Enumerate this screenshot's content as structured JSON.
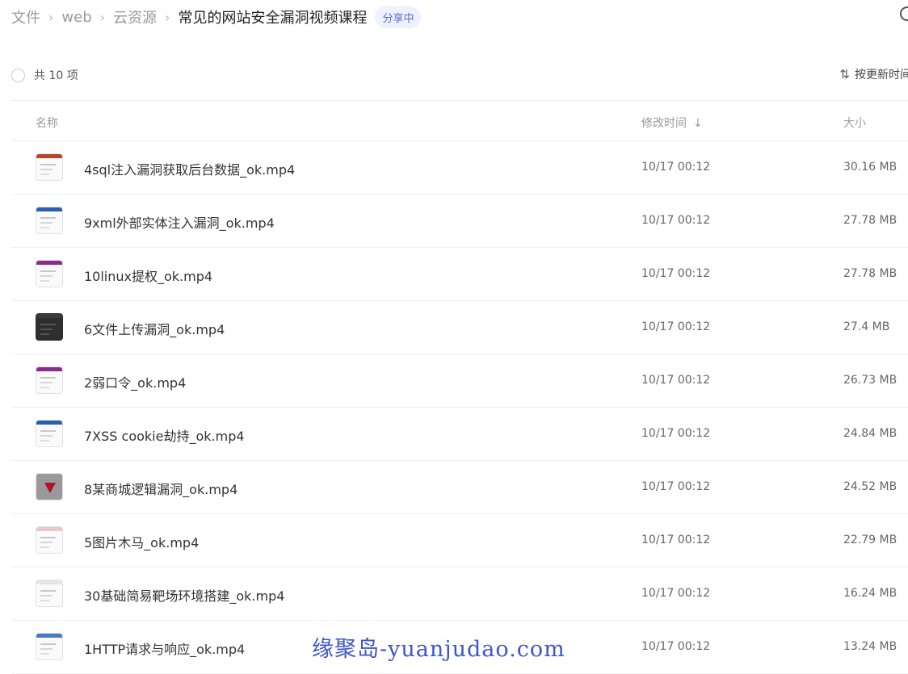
{
  "breadcrumb": {
    "items": [
      "文件",
      "web",
      "云资源"
    ],
    "current": "常见的网站安全漏洞视频课程",
    "badge": "分享中"
  },
  "toolbar": {
    "count_label": "共 10 项",
    "sort_label": "按更新时间"
  },
  "columns": {
    "name": "名称",
    "time": "修改时间",
    "size": "大小",
    "time_sort_arrow": "↓"
  },
  "files": [
    {
      "name": "4sql注入漏洞获取后台数据_ok.mp4",
      "time": "10/17 00:12",
      "size": "30.16 MB",
      "thumb_color": "#b5462a"
    },
    {
      "name": "9xml外部实体注入漏洞_ok.mp4",
      "time": "10/17 00:12",
      "size": "27.78 MB",
      "thumb_color": "#2b5fb4"
    },
    {
      "name": "10linux提权_ok.mp4",
      "time": "10/17 00:12",
      "size": "27.78 MB",
      "thumb_color": "#8a2a8a"
    },
    {
      "name": "6文件上传漏洞_ok.mp4",
      "time": "10/17 00:12",
      "size": "27.4 MB",
      "thumb_color": "#3a3a3a"
    },
    {
      "name": "2弱口令_ok.mp4",
      "time": "10/17 00:12",
      "size": "26.73 MB",
      "thumb_color": "#8a2a8a"
    },
    {
      "name": "7XSS cookie劫持_ok.mp4",
      "time": "10/17 00:12",
      "size": "24.84 MB",
      "thumb_color": "#2b5fb4"
    },
    {
      "name": "8某商城逻辑漏洞_ok.mp4",
      "time": "10/17 00:12",
      "size": "24.52 MB",
      "thumb_color": "#b3112a"
    },
    {
      "name": "5图片木马_ok.mp4",
      "time": "10/17 00:12",
      "size": "22.79 MB",
      "thumb_color": "#e8c8c8"
    },
    {
      "name": "30基础简易靶场环境搭建_ok.mp4",
      "time": "10/17 00:12",
      "size": "16.24 MB",
      "thumb_color": "#e6e6e6"
    },
    {
      "name": "1HTTP请求与响应_ok.mp4",
      "time": "10/17 00:12",
      "size": "13.24 MB",
      "thumb_color": "#4a78c8"
    }
  ],
  "watermark": "缘聚岛-yuanjudao.com",
  "colors": {
    "accent": "#5b6bd8",
    "badge_bg": "#eef1ff",
    "watermark": "#3f55c8"
  }
}
